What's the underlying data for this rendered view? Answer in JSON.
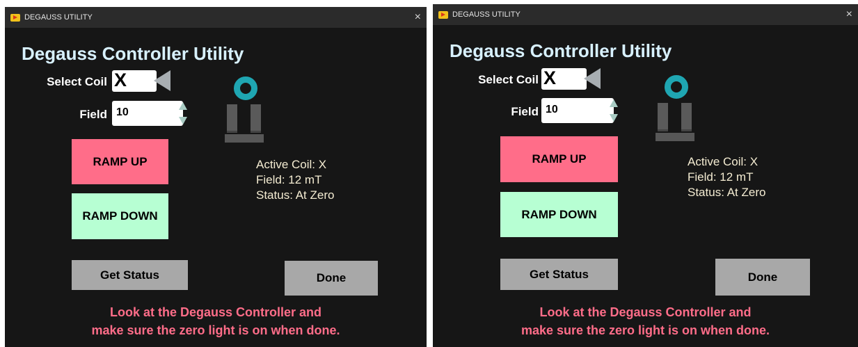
{
  "windows": [
    {
      "title": "DEGAUSS UTILITY",
      "close_glyph": "×",
      "heading": "Degauss Controller Utility",
      "select_coil_label": "Select Coil",
      "coil_value": "X",
      "field_label": "Field",
      "field_value": "10",
      "ramp_up_label": "RAMP UP",
      "ramp_down_label": "RAMP DOWN",
      "get_status_label": "Get Status",
      "done_label": "Done",
      "status": {
        "active_coil": "Active Coil: X",
        "field": "Field: 12 mT",
        "state": "Status: At Zero"
      },
      "message_line1": "Look at the Degauss Controller and",
      "message_line2": "make sure the zero light is on when done."
    },
    {
      "title": "DEGAUSS UTILITY",
      "close_glyph": "×",
      "heading": "Degauss Controller Utility",
      "select_coil_label": "Select Coil",
      "coil_value": "X",
      "field_label": "Field",
      "field_value": "10",
      "ramp_up_label": "RAMP UP",
      "ramp_down_label": "RAMP DOWN",
      "get_status_label": "Get Status",
      "done_label": "Done",
      "status": {
        "active_coil": "Active Coil: X",
        "field": "Field: 12 mT",
        "state": "Status: At Zero"
      },
      "message_line1": "Look at the Degauss Controller and",
      "message_line2": "make sure the zero light is on when done."
    }
  ],
  "colors": {
    "background": "#161616",
    "titlebar": "#2b2b2b",
    "heading": "#d8f1ff",
    "ramp_up": "#ff6d89",
    "ramp_down": "#b7ffd3",
    "grey_button": "#a8a8a8",
    "message": "#ff6d89",
    "status_text": "#f4ecd2",
    "magnet_ring": "#1fa6b2"
  },
  "icons": [
    "app-icon",
    "close-icon",
    "coil-selector-arrow-icon",
    "field-spinner-icon",
    "magnet-coil-icon"
  ]
}
